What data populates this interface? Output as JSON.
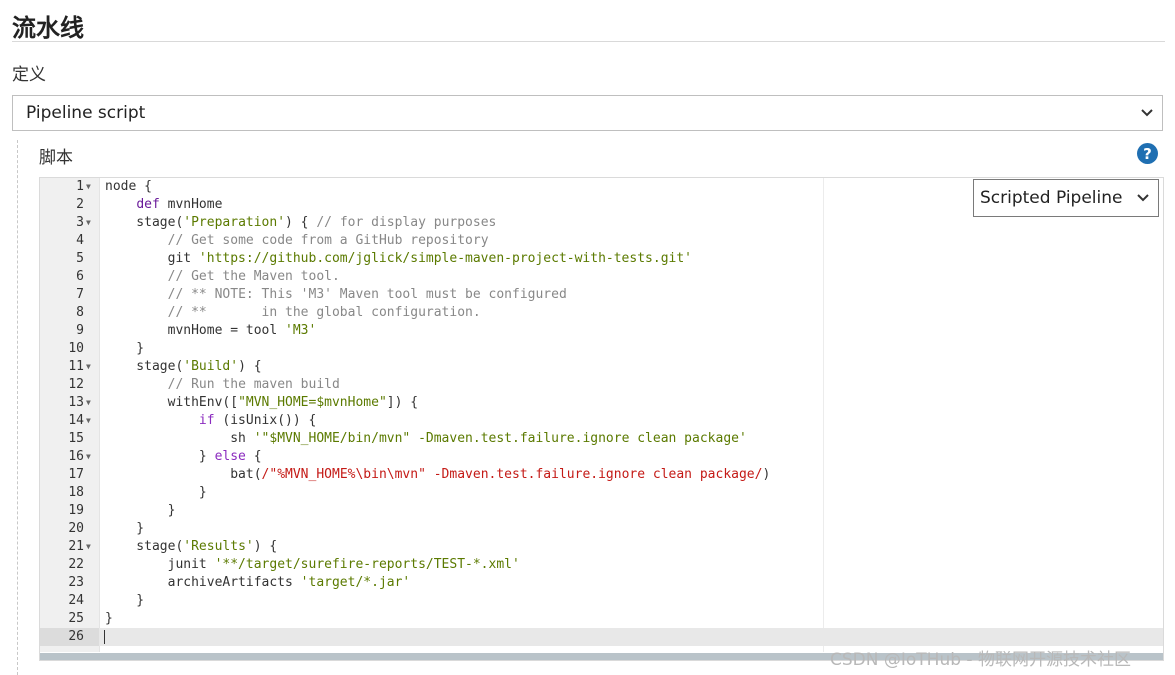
{
  "section": {
    "title": "流水线",
    "definition_label": "定义"
  },
  "definition_select": {
    "value": "Pipeline script"
  },
  "script": {
    "label": "脚本",
    "help_icon": "?",
    "type_select": "Scripted Pipeline",
    "lines": [
      {
        "n": "1",
        "fold": true,
        "segs": [
          [
            "",
            "node {"
          ]
        ]
      },
      {
        "n": "2",
        "segs": [
          [
            "",
            "    "
          ],
          [
            "kw",
            "def"
          ],
          [
            "",
            " mvnHome"
          ]
        ]
      },
      {
        "n": "3",
        "fold": true,
        "segs": [
          [
            "",
            "    stage("
          ],
          [
            "str",
            "'Preparation'"
          ],
          [
            "",
            ") { "
          ],
          [
            "cmt",
            "// for display purposes"
          ]
        ]
      },
      {
        "n": "4",
        "segs": [
          [
            "",
            "        "
          ],
          [
            "cmt",
            "// Get some code from a GitHub repository"
          ]
        ]
      },
      {
        "n": "5",
        "segs": [
          [
            "",
            "        git "
          ],
          [
            "str",
            "'https://github.com/jglick/simple-maven-project-with-tests.git'"
          ]
        ]
      },
      {
        "n": "6",
        "segs": [
          [
            "",
            "        "
          ],
          [
            "cmt",
            "// Get the Maven tool."
          ]
        ]
      },
      {
        "n": "7",
        "segs": [
          [
            "",
            "        "
          ],
          [
            "cmt",
            "// ** NOTE: This 'M3' Maven tool must be configured"
          ]
        ]
      },
      {
        "n": "8",
        "segs": [
          [
            "",
            "        "
          ],
          [
            "cmt",
            "// **       in the global configuration."
          ]
        ]
      },
      {
        "n": "9",
        "segs": [
          [
            "",
            "        mvnHome = tool "
          ],
          [
            "str",
            "'M3'"
          ]
        ]
      },
      {
        "n": "10",
        "segs": [
          [
            "",
            "    }"
          ]
        ]
      },
      {
        "n": "11",
        "fold": true,
        "segs": [
          [
            "",
            "    stage("
          ],
          [
            "str",
            "'Build'"
          ],
          [
            "",
            ") {"
          ]
        ]
      },
      {
        "n": "12",
        "segs": [
          [
            "",
            "        "
          ],
          [
            "cmt",
            "// Run the maven build"
          ]
        ]
      },
      {
        "n": "13",
        "fold": true,
        "segs": [
          [
            "",
            "        withEnv(["
          ],
          [
            "str",
            "\"MVN_HOME=$mvnHome\""
          ],
          [
            "",
            "]) {"
          ]
        ]
      },
      {
        "n": "14",
        "fold": true,
        "segs": [
          [
            "",
            "            "
          ],
          [
            "kw2",
            "if"
          ],
          [
            "",
            " (isUnix()) {"
          ]
        ]
      },
      {
        "n": "15",
        "segs": [
          [
            "",
            "                sh "
          ],
          [
            "str",
            "'\"$MVN_HOME/bin/mvn\" -Dmaven.test.failure.ignore clean package'"
          ]
        ]
      },
      {
        "n": "16",
        "fold": true,
        "segs": [
          [
            "",
            "            } "
          ],
          [
            "kw2",
            "else"
          ],
          [
            "",
            " {"
          ]
        ]
      },
      {
        "n": "17",
        "segs": [
          [
            "",
            "                bat("
          ],
          [
            "str2",
            "/\"%MVN_HOME%\\bin\\mvn\" -Dmaven.test.failure.ignore clean package/"
          ],
          [
            "",
            ")"
          ]
        ]
      },
      {
        "n": "18",
        "segs": [
          [
            "",
            "            }"
          ]
        ]
      },
      {
        "n": "19",
        "segs": [
          [
            "",
            "        }"
          ]
        ]
      },
      {
        "n": "20",
        "segs": [
          [
            "",
            "    }"
          ]
        ]
      },
      {
        "n": "21",
        "fold": true,
        "segs": [
          [
            "",
            "    stage("
          ],
          [
            "str",
            "'Results'"
          ],
          [
            "",
            ") {"
          ]
        ]
      },
      {
        "n": "22",
        "segs": [
          [
            "",
            "        junit "
          ],
          [
            "str",
            "'**/target/surefire-reports/TEST-*.xml'"
          ]
        ]
      },
      {
        "n": "23",
        "segs": [
          [
            "",
            "        archiveArtifacts "
          ],
          [
            "str",
            "'target/*.jar'"
          ]
        ]
      },
      {
        "n": "24",
        "segs": [
          [
            "",
            "    }"
          ]
        ]
      },
      {
        "n": "25",
        "segs": [
          [
            "",
            "}"
          ]
        ]
      },
      {
        "n": "26",
        "active": true,
        "segs": []
      }
    ]
  },
  "watermark": "CSDN @IoTHub - 物联网开源技术社区"
}
